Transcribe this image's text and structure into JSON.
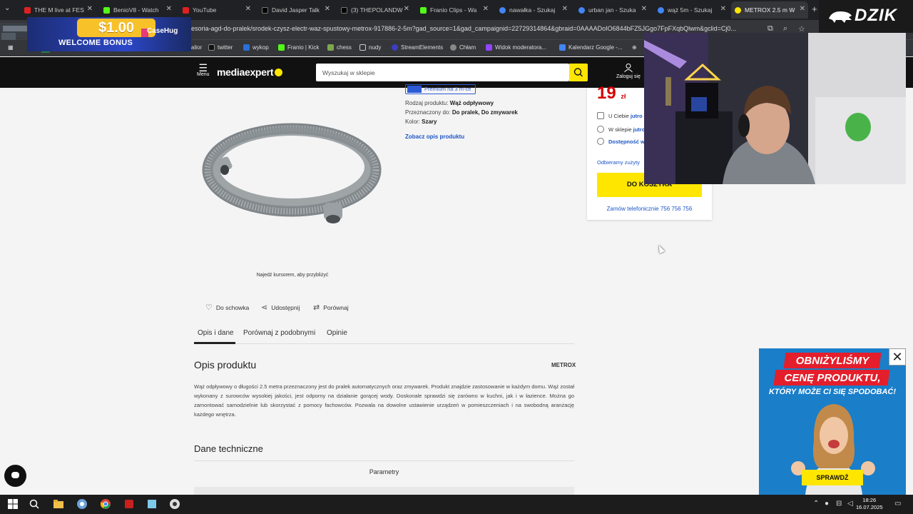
{
  "browser": {
    "tabs": [
      {
        "label": "THE M live at FES",
        "color": "#e02020"
      },
      {
        "label": "BenioV8 - Watch",
        "color": "#53fc18"
      },
      {
        "label": "YouTube",
        "color": "#e02020"
      },
      {
        "label": "David Jasper Talk",
        "color": "#111111"
      },
      {
        "label": "(3)  THEPOLANDW",
        "color": "#111111"
      },
      {
        "label": "Franio Clips - Wa",
        "color": "#53fc18"
      },
      {
        "label": "nawałka - Szukaj",
        "color": "#4285f4"
      },
      {
        "label": "urban jan - Szuka",
        "color": "#4285f4"
      },
      {
        "label": "wąż 5m - Szukaj",
        "color": "#4285f4"
      },
      {
        "label": "METROX 2.5 m W",
        "color": "#ffe600"
      }
    ],
    "url": "esoria-agd-do-pralek/srodek-czysz-electr-waz-spustowy-metrox-917886-2-5m?gad_source=1&gad_campaignid=22729314864&gbraid=0AAAADoIO6844bFZ5JGgo7FpFXqbQlwm&gclid=Cj0...",
    "bookmarks": [
      {
        "label": "alior",
        "color": "#bb3333"
      },
      {
        "label": "twitter",
        "color": "#111111"
      },
      {
        "label": "wykop",
        "color": "#2a6fd6"
      },
      {
        "label": "Franio | Kick",
        "color": "#53fc18"
      },
      {
        "label": "chess",
        "color": "#7fa650"
      },
      {
        "label": "nudy",
        "color": "#777777"
      },
      {
        "label": "StreamElements",
        "color": "#3d3dc4"
      },
      {
        "label": "Chłam",
        "color": "#888888"
      },
      {
        "label": "Widok moderatora...",
        "color": "#9146ff"
      },
      {
        "label": "Kalendarz Google -...",
        "color": "#4285f4"
      }
    ]
  },
  "overlays": {
    "casehug_amount": "$1.00",
    "casehug_bonus": "WELCOME BONUS",
    "casehug_brand": "CaseHug",
    "dzik": "DZIK"
  },
  "site": {
    "menu_label": "Menu",
    "logo": "mediaexpert",
    "search_placeholder": "Wyszukaj w sklepie",
    "login_label": "Zaloguj się"
  },
  "product": {
    "premium": "Premium na 3 m-ce",
    "attrs": [
      {
        "label": "Rodzaj produktu:",
        "value": "Wąż odpływowy"
      },
      {
        "label": "Przeznaczony do:",
        "value": "Do pralek, Do zmywarek"
      },
      {
        "label": "Kolor:",
        "value": "Szary"
      }
    ],
    "see_description": "Zobacz opis produktu",
    "zoom_hint": "Najedź kursorem, aby przybliżyć",
    "price": "19",
    "currency": "zł",
    "availability": [
      {
        "text": "U Ciebie",
        "strong": "jutro"
      },
      {
        "text": "W sklepie",
        "strong": "jutro"
      },
      {
        "text": "",
        "strong": "Dostępność w"
      }
    ],
    "recycle": "Odbieramy zużyty",
    "cart_button": "DO KOSZYKA",
    "phone_order": "Zamów telefonicznie 756 756 756",
    "actions": [
      "Do schowka",
      "Udostępnij",
      "Porównaj"
    ],
    "tabs": [
      "Opis i dane",
      "Porównaj z podobnymi",
      "Opinie"
    ],
    "description_title": "Opis produktu",
    "brand": "METROX",
    "description": "Wąż odpływowy o długości 2.5 metra przeznaczony jest do pralek automatycznych oraz zmywarek. Produkt znajdzie zastosowanie w każdym domu. Wąż został wykonany z surowców wysokiej jakości, jest odporny na działanie gorącej wody. Doskonale sprawdzi się zarówno w kuchni, jak i w łazience. Można go zamontować samodzielnie lub skorzystać z pomocy fachowców. Pozwala na dowolne ustawienie urządzeń w pomieszczeniach i na swobodną aranżację każdego wnętrza.",
    "tech_title": "Dane techniczne",
    "params_label": "Parametry"
  },
  "ad": {
    "line1": "OBNIŻYLIŚMY",
    "line2": "CENĘ PRODUKTU,",
    "line3": "KTÓRY MOŻE CI SIĘ SPODOBAĆ!",
    "button": "SPRAWDŹ"
  },
  "taskbar": {
    "time": "18:26",
    "date": "16.07.2025"
  },
  "colors": {
    "accent_yellow": "#ffe600",
    "price_red": "#d40000",
    "link_blue": "#1d56c7"
  }
}
